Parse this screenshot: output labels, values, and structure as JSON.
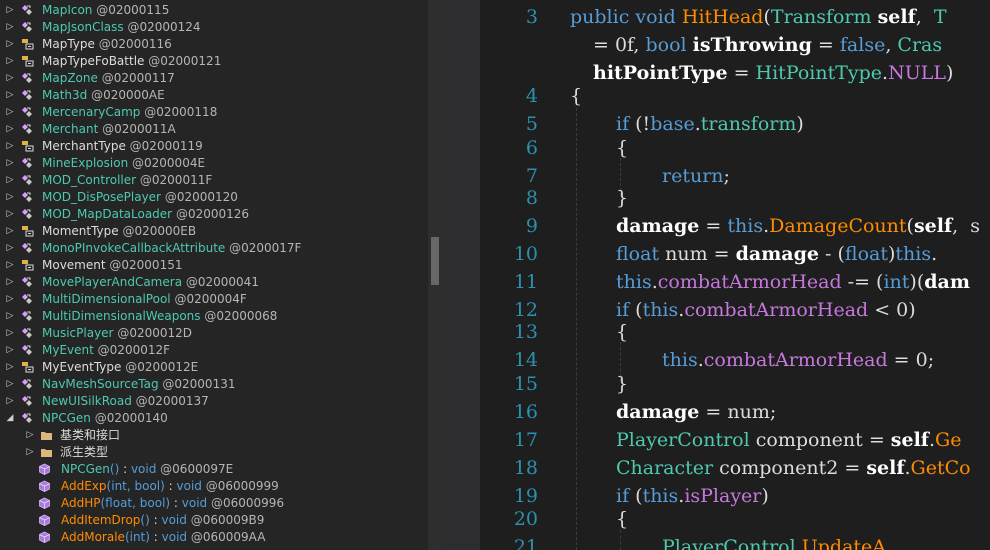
{
  "tree": {
    "items": [
      {
        "name": "MapIcon",
        "token": "@02000115",
        "kind": "class",
        "expanded": false
      },
      {
        "name": "MapJsonClass",
        "token": "@02000124",
        "kind": "class",
        "expanded": false
      },
      {
        "name": "MapType",
        "token": "@02000116",
        "kind": "enum",
        "expanded": false
      },
      {
        "name": "MapTypeFoBattle",
        "token": "@02000121",
        "kind": "enum",
        "expanded": false
      },
      {
        "name": "MapZone",
        "token": "@02000117",
        "kind": "class",
        "expanded": false
      },
      {
        "name": "Math3d",
        "token": "@020000AE",
        "kind": "class",
        "expanded": false
      },
      {
        "name": "MercenaryCamp",
        "token": "@02000118",
        "kind": "class",
        "expanded": false
      },
      {
        "name": "Merchant",
        "token": "@0200011A",
        "kind": "class",
        "expanded": false
      },
      {
        "name": "MerchantType",
        "token": "@02000119",
        "kind": "enum",
        "expanded": false
      },
      {
        "name": "MineExplosion",
        "token": "@0200004E",
        "kind": "class",
        "expanded": false
      },
      {
        "name": "MOD_Controller",
        "token": "@0200011F",
        "kind": "class",
        "expanded": false
      },
      {
        "name": "MOD_DisPosePlayer",
        "token": "@02000120",
        "kind": "class",
        "expanded": false
      },
      {
        "name": "MOD_MapDataLoader",
        "token": "@02000126",
        "kind": "class",
        "expanded": false
      },
      {
        "name": "MomentType",
        "token": "@020000EB",
        "kind": "enum",
        "expanded": false
      },
      {
        "name": "MonoPInvokeCallbackAttribute",
        "token": "@0200017F",
        "kind": "class",
        "expanded": false
      },
      {
        "name": "Movement",
        "token": "@02000151",
        "kind": "enum",
        "expanded": false
      },
      {
        "name": "MovePlayerAndCamera",
        "token": "@02000041",
        "kind": "class",
        "expanded": false
      },
      {
        "name": "MultiDimensionalPool",
        "token": "@0200004F",
        "kind": "class",
        "expanded": false
      },
      {
        "name": "MultiDimensionalWeapons",
        "token": "@02000068",
        "kind": "class",
        "expanded": false
      },
      {
        "name": "MusicPlayer",
        "token": "@0200012D",
        "kind": "class",
        "expanded": false
      },
      {
        "name": "MyEvent",
        "token": "@0200012F",
        "kind": "class",
        "expanded": false
      },
      {
        "name": "MyEventType",
        "token": "@0200012E",
        "kind": "enum",
        "expanded": false
      },
      {
        "name": "NavMeshSourceTag",
        "token": "@02000131",
        "kind": "class",
        "expanded": false
      },
      {
        "name": "NewUISilkRoad",
        "token": "@02000137",
        "kind": "class",
        "expanded": false
      },
      {
        "name": "NPCGen",
        "token": "@02000140",
        "kind": "class",
        "expanded": true
      }
    ],
    "folders": [
      "基类和接口",
      "派生类型"
    ],
    "members": [
      {
        "name": "NPCGen",
        "params": "()",
        "colon": " : ",
        "ret": "void",
        "token": "@0600097E",
        "ctor": true
      },
      {
        "name": "AddExp",
        "params": "(int, bool)",
        "colon": " : ",
        "ret": "void",
        "token": "@06000999",
        "ctor": false
      },
      {
        "name": "AddHP",
        "params": "(float, bool)",
        "colon": " : ",
        "ret": "void",
        "token": "@06000996",
        "ctor": false
      },
      {
        "name": "AddItemDrop",
        "params": "()",
        "colon": " : ",
        "ret": "void",
        "token": "@060009B9",
        "ctor": false
      },
      {
        "name": "AddMorale",
        "params": "(int)",
        "colon": " : ",
        "ret": "void",
        "token": "@060009AA",
        "ctor": false
      }
    ]
  },
  "editor": {
    "lines": [
      {
        "num": "3",
        "indent": 0,
        "toks": [
          [
            "public",
            "kw"
          ],
          [
            " ",
            "punc"
          ],
          [
            "void",
            "kw"
          ],
          [
            " ",
            "punc"
          ],
          [
            "HitHead",
            "meth"
          ],
          [
            "(",
            "punc"
          ],
          [
            "Transform",
            "type"
          ],
          [
            " ",
            "punc"
          ],
          [
            "self",
            "bold"
          ],
          [
            ",  ",
            "punc"
          ],
          [
            "T",
            "type"
          ]
        ]
      },
      {
        "num": "",
        "indent": 1,
        "toks": [
          [
            "= 0f, ",
            "punc"
          ],
          [
            "bool",
            "kw"
          ],
          [
            " ",
            "punc"
          ],
          [
            "isThrowing",
            "bold"
          ],
          [
            " = ",
            "punc"
          ],
          [
            "false",
            "kw"
          ],
          [
            ", ",
            "punc"
          ],
          [
            "Cras",
            "type"
          ]
        ]
      },
      {
        "num": "",
        "indent": 1,
        "toks": [
          [
            "hitPointType",
            "bold"
          ],
          [
            " = ",
            "punc"
          ],
          [
            "HitPointType",
            "type"
          ],
          [
            ".",
            "punc"
          ],
          [
            "NULL",
            "prop"
          ],
          [
            ")",
            "punc"
          ]
        ]
      },
      {
        "num": "4",
        "indent": 0,
        "toks": [
          [
            "{",
            "punc"
          ]
        ]
      },
      {
        "num": "5",
        "indent": 2,
        "toks": [
          [
            "if",
            "kw"
          ],
          [
            " (!",
            "punc"
          ],
          [
            "base",
            "kw"
          ],
          [
            ".",
            "punc"
          ],
          [
            "transform",
            "type"
          ],
          [
            ")",
            "punc"
          ]
        ]
      },
      {
        "num": "6",
        "indent": 2,
        "toks": [
          [
            "{",
            "punc"
          ]
        ]
      },
      {
        "num": "7",
        "indent": 4,
        "toks": [
          [
            "return",
            "kw"
          ],
          [
            ";",
            "punc"
          ]
        ]
      },
      {
        "num": "8",
        "indent": 2,
        "toks": [
          [
            "}",
            "punc"
          ]
        ]
      },
      {
        "num": "9",
        "indent": 2,
        "toks": [
          [
            "damage",
            "bold"
          ],
          [
            " = ",
            "punc"
          ],
          [
            "this",
            "kw"
          ],
          [
            ".",
            "punc"
          ],
          [
            "DamageCount",
            "meth"
          ],
          [
            "(",
            "punc"
          ],
          [
            "self",
            "bold"
          ],
          [
            ",  s",
            "punc"
          ]
        ]
      },
      {
        "num": "10",
        "indent": 2,
        "toks": [
          [
            "float",
            "kw"
          ],
          [
            " num = ",
            "punc"
          ],
          [
            "damage",
            "bold"
          ],
          [
            " - (",
            "punc"
          ],
          [
            "float",
            "kw"
          ],
          [
            ")",
            "punc"
          ],
          [
            "this",
            "kw"
          ],
          [
            ".",
            "punc"
          ]
        ]
      },
      {
        "num": "11",
        "indent": 2,
        "toks": [
          [
            "this",
            "kw"
          ],
          [
            ".",
            "punc"
          ],
          [
            "combatArmorHead",
            "prop"
          ],
          [
            " -= (",
            "punc"
          ],
          [
            "int",
            "kw"
          ],
          [
            ")(",
            "punc"
          ],
          [
            "dam",
            "bold"
          ]
        ]
      },
      {
        "num": "12",
        "indent": 2,
        "toks": [
          [
            "if",
            "kw"
          ],
          [
            " (",
            "punc"
          ],
          [
            "this",
            "kw"
          ],
          [
            ".",
            "punc"
          ],
          [
            "combatArmorHead",
            "prop"
          ],
          [
            " < 0)",
            "punc"
          ]
        ]
      },
      {
        "num": "13",
        "indent": 2,
        "toks": [
          [
            "{",
            "punc"
          ]
        ]
      },
      {
        "num": "14",
        "indent": 4,
        "toks": [
          [
            "this",
            "kw"
          ],
          [
            ".",
            "punc"
          ],
          [
            "combatArmorHead",
            "prop"
          ],
          [
            " = 0;",
            "punc"
          ]
        ]
      },
      {
        "num": "15",
        "indent": 2,
        "toks": [
          [
            "}",
            "punc"
          ]
        ]
      },
      {
        "num": "16",
        "indent": 2,
        "toks": [
          [
            "damage",
            "bold"
          ],
          [
            " = num;",
            "punc"
          ]
        ]
      },
      {
        "num": "17",
        "indent": 2,
        "toks": [
          [
            "PlayerControl",
            "type"
          ],
          [
            " component = ",
            "punc"
          ],
          [
            "self",
            "bold"
          ],
          [
            ".",
            "punc"
          ],
          [
            "Ge",
            "meth"
          ]
        ]
      },
      {
        "num": "18",
        "indent": 2,
        "toks": [
          [
            "Character",
            "type"
          ],
          [
            " component2 = ",
            "punc"
          ],
          [
            "self",
            "bold"
          ],
          [
            ".",
            "punc"
          ],
          [
            "GetCo",
            "meth"
          ]
        ]
      },
      {
        "num": "19",
        "indent": 2,
        "toks": [
          [
            "if",
            "kw"
          ],
          [
            " (",
            "punc"
          ],
          [
            "this",
            "kw"
          ],
          [
            ".",
            "punc"
          ],
          [
            "isPlayer",
            "prop"
          ],
          [
            ")",
            "punc"
          ]
        ]
      },
      {
        "num": "20",
        "indent": 2,
        "toks": [
          [
            "{",
            "punc"
          ]
        ]
      },
      {
        "num": "21",
        "indent": 4,
        "toks": [
          [
            "PlayerControl",
            "type"
          ],
          [
            ".",
            "punc"
          ],
          [
            "UpdateA",
            "meth"
          ]
        ]
      }
    ]
  }
}
